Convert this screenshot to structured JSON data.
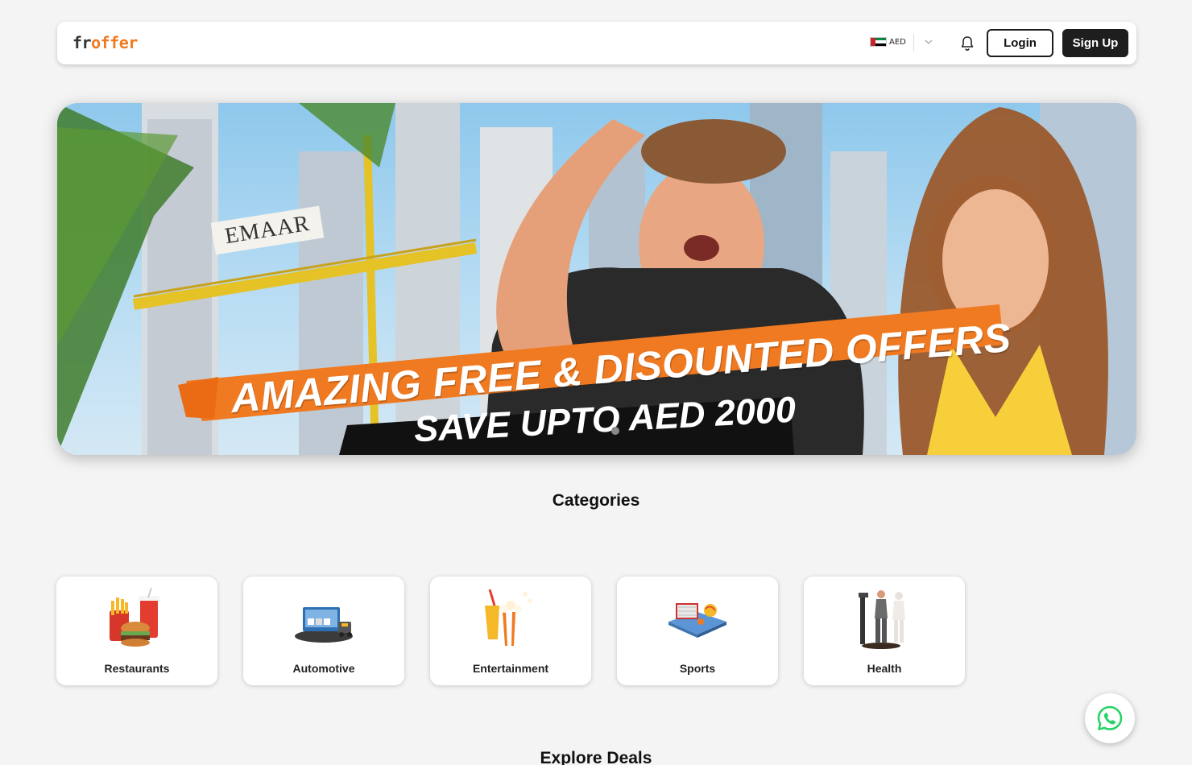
{
  "header": {
    "logo": {
      "part1": "fr",
      "part2": "offer"
    },
    "currency": "AED",
    "login_label": "Login",
    "signup_label": "Sign Up"
  },
  "hero": {
    "sign_text": "EMAAR",
    "headline": "AMAZING FREE & DISOUNTED OFFERS",
    "subheadline": "SAVE UPTO AED 2000"
  },
  "categories": {
    "title": "Categories",
    "items": [
      {
        "label": "Restaurants",
        "icon": "restaurant-icon"
      },
      {
        "label": "Automotive",
        "icon": "automotive-icon"
      },
      {
        "label": "Entertainment",
        "icon": "entertainment-icon"
      },
      {
        "label": "Sports",
        "icon": "sports-icon"
      },
      {
        "label": "Health",
        "icon": "health-icon"
      }
    ]
  },
  "explore": {
    "title": "Explore Deals"
  },
  "colors": {
    "brand": "#f07a22",
    "dark": "#1e1e1e",
    "whatsapp": "#25d366"
  }
}
